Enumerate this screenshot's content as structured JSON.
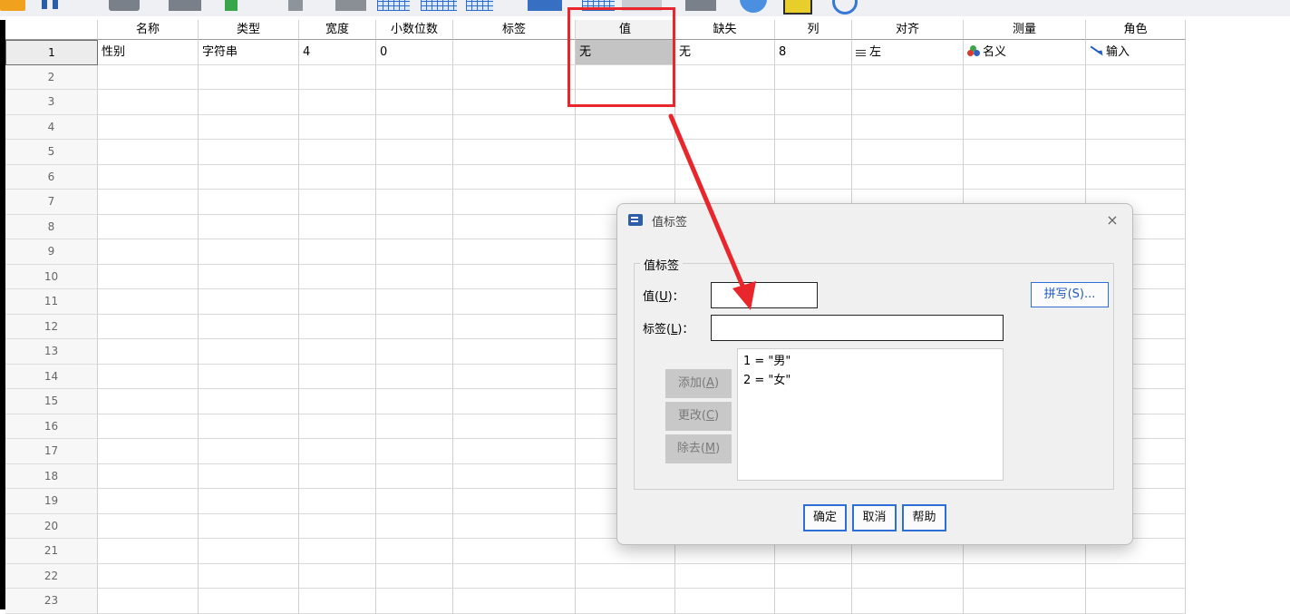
{
  "header": {
    "columns": [
      "名称",
      "类型",
      "宽度",
      "小数位数",
      "标签",
      "值",
      "缺失",
      "列",
      "对齐",
      "测量",
      "角色"
    ]
  },
  "rows": {
    "numbers": [
      "1",
      "2",
      "3",
      "4",
      "5",
      "6",
      "7",
      "8",
      "9",
      "10",
      "11",
      "12",
      "13",
      "14",
      "15",
      "16",
      "17",
      "18",
      "19",
      "20",
      "21",
      "22",
      "23"
    ],
    "first": {
      "name": "性别",
      "type": "字符串",
      "width": "4",
      "decimals": "0",
      "label": "",
      "values": "无",
      "missing": "无",
      "columns": "8",
      "align": "左",
      "measure": "名义",
      "role": "输入"
    }
  },
  "icons": {
    "align": "align-left-icon",
    "measure": "nominal-measure-icon",
    "role": "input-role-icon"
  },
  "annotation": {
    "color": "#e8262b"
  },
  "dialog": {
    "title": "值标签",
    "close": "×",
    "group_label": "值标签",
    "value_label": "值(U)：",
    "label_label": "标签(L)：",
    "value_input": "",
    "label_input": "",
    "spell_button": "拼写(S)...",
    "list_items": [
      "1 = \"男\"",
      "2 = \"女\""
    ],
    "add_button": "添加(A)",
    "change_button": "更改(C)",
    "remove_button": "除去(M)",
    "ok_button": "确定",
    "cancel_button": "取消",
    "help_button": "帮助"
  }
}
